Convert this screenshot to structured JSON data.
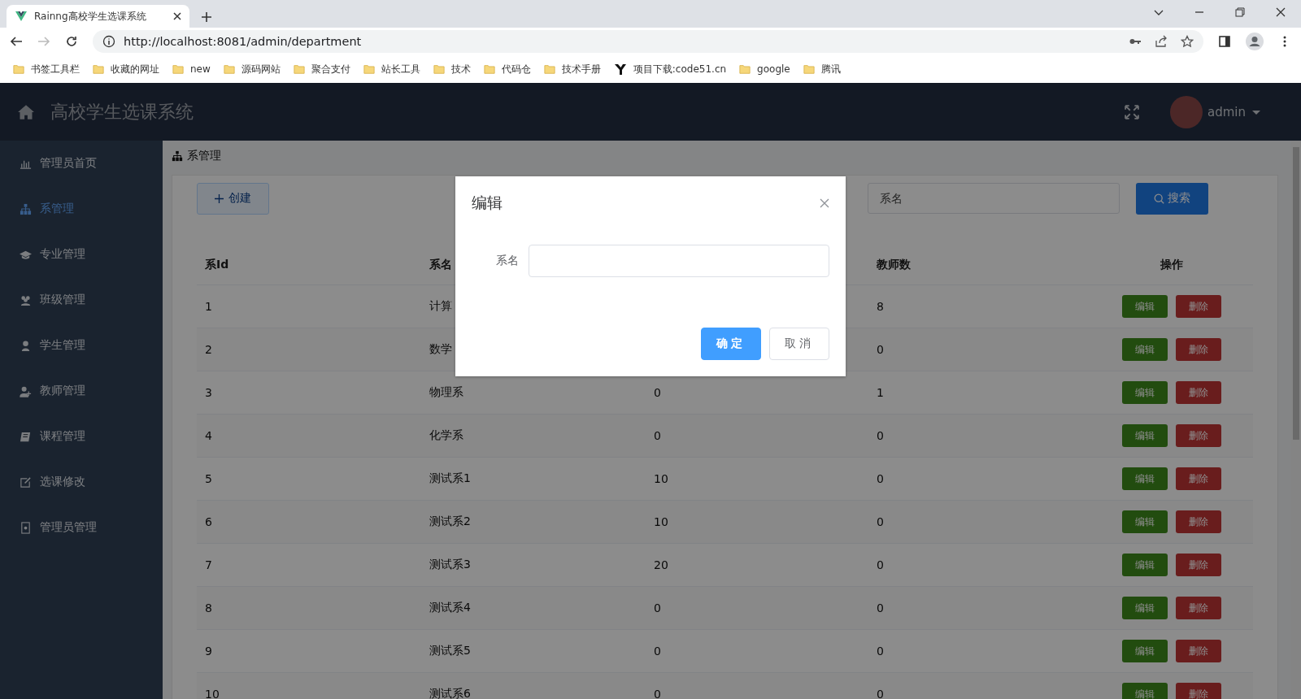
{
  "browser": {
    "tab_title": "Rainng高校学生选课系统",
    "address": "http://localhost:8081/admin/department",
    "bookmarks": [
      {
        "kind": "folder",
        "label": "书签工具栏"
      },
      {
        "kind": "folder",
        "label": "收藏的网址"
      },
      {
        "kind": "folder",
        "label": "new"
      },
      {
        "kind": "folder",
        "label": "源码网站"
      },
      {
        "kind": "folder",
        "label": "聚合支付"
      },
      {
        "kind": "folder",
        "label": "站长工具"
      },
      {
        "kind": "folder",
        "label": "技术"
      },
      {
        "kind": "folder",
        "label": "代码仓"
      },
      {
        "kind": "folder",
        "label": "技术手册"
      },
      {
        "kind": "site",
        "label": "项目下载:code51.cn"
      },
      {
        "kind": "folder",
        "label": "google"
      },
      {
        "kind": "folder",
        "label": "腾讯"
      }
    ]
  },
  "header": {
    "title": "高校学生选课系统",
    "user": "admin"
  },
  "sidebar": {
    "items": [
      {
        "label": "管理员首页",
        "selected": false
      },
      {
        "label": "系管理",
        "selected": true
      },
      {
        "label": "专业管理",
        "selected": false
      },
      {
        "label": "班级管理",
        "selected": false
      },
      {
        "label": "学生管理",
        "selected": false
      },
      {
        "label": "教师管理",
        "selected": false
      },
      {
        "label": "课程管理",
        "selected": false
      },
      {
        "label": "选课修改",
        "selected": false
      },
      {
        "label": "管理员管理",
        "selected": false
      }
    ]
  },
  "breadcrumb": "系管理",
  "toolbar": {
    "create_button": "创建",
    "search": {
      "placeholder": "系名"
    },
    "search_button": "搜索"
  },
  "table": {
    "header": {
      "column_1": "系Id",
      "column_2": "系名",
      "column_4": "教师数",
      "column_5": "操作"
    },
    "rows": [
      {
        "id": "1",
        "name": "计算",
        "teachers": "8",
        "actions": [
          "编辑",
          "删除"
        ]
      },
      {
        "id": "2",
        "name": "数学",
        "teachers": "0",
        "actions": [
          "编辑",
          "删除"
        ]
      },
      {
        "id": "3",
        "name": "物理系",
        "column_3": "0",
        "teachers": "1",
        "actions": [
          "编辑",
          "删除"
        ]
      },
      {
        "id": "4",
        "name": "化学系",
        "column_3": "0",
        "teachers": "0",
        "actions": [
          "编辑",
          "删除"
        ]
      },
      {
        "id": "5",
        "name": "测试系1",
        "column_3": "10",
        "teachers": "0",
        "actions": [
          "编辑",
          "删除"
        ]
      },
      {
        "id": "6",
        "name": "测试系2",
        "column_3": "10",
        "teachers": "0",
        "actions": [
          "编辑",
          "删除"
        ]
      },
      {
        "id": "7",
        "name": "测试系3",
        "column_3": "20",
        "teachers": "0",
        "actions": [
          "编辑",
          "删除"
        ]
      },
      {
        "id": "8",
        "name": "测试系4",
        "column_3": "0",
        "teachers": "0",
        "actions": [
          "编辑",
          "删除"
        ]
      },
      {
        "id": "9",
        "name": "测试系5",
        "column_3": "0",
        "teachers": "0",
        "actions": [
          "编辑",
          "删除"
        ]
      },
      {
        "id": "10",
        "name": "测试系6",
        "column_3": "0",
        "teachers": "0",
        "actions": [
          "编辑",
          "删除"
        ]
      }
    ]
  },
  "dialog": {
    "title": "编辑",
    "field_label": "系名",
    "buttons": [
      "确定",
      "取消"
    ]
  }
}
